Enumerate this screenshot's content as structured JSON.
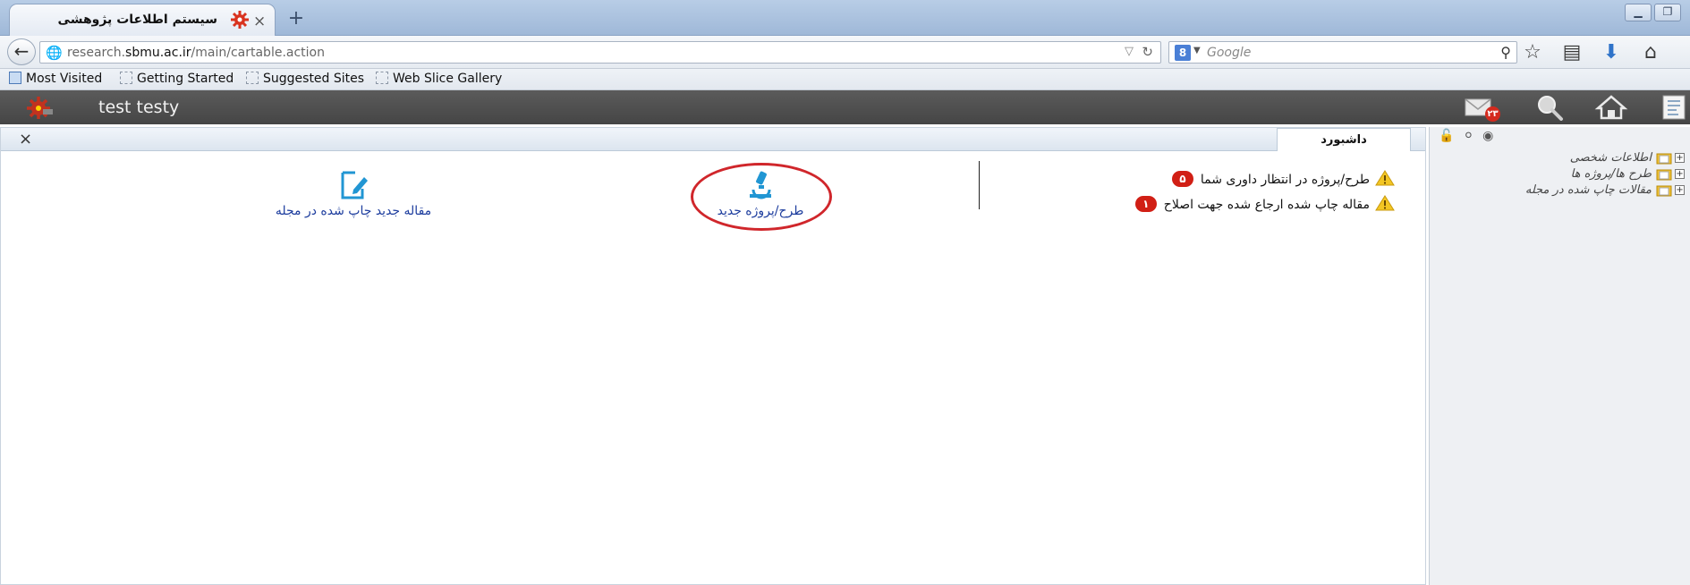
{
  "browser": {
    "tab_title": "سیستم اطلاعات پژوهشی",
    "tab_close": "×",
    "new_tab": "+",
    "url_prefix": "research.",
    "url_domain": "sbmu.ac.ir",
    "url_path": "/main/cartable.action",
    "search_engine_label": "8",
    "search_placeholder": "Google",
    "bookmarks": [
      {
        "label": "Most Visited",
        "icon": "ie-icon"
      },
      {
        "label": "Getting Started",
        "icon": "bookmark-icon"
      },
      {
        "label": "Suggested Sites",
        "icon": "bookmark-icon"
      },
      {
        "label": "Web Slice Gallery",
        "icon": "bookmark-icon"
      }
    ]
  },
  "app": {
    "user_name": "test testy",
    "mail_count": "۲۳",
    "accent": "#d11f15"
  },
  "pane": {
    "close": "×",
    "tab_label": "داشبورد"
  },
  "notifications": [
    {
      "text": "طرح/پروژه در انتظار داوری شما",
      "count": "۵"
    },
    {
      "text": "مقاله چاپ شده ارجاع شده جهت اصلاح",
      "count": "۱"
    }
  ],
  "actions": {
    "new_project": "طرح/پروژه جدید",
    "new_article": "مقاله جدید چاپ شده در مجله"
  },
  "sidebar": {
    "tree": [
      {
        "label": "اطلاعات شخصی"
      },
      {
        "label": "طرح ها/پروژه ها"
      },
      {
        "label": "مقالات چاپ شده در مجله"
      }
    ]
  }
}
